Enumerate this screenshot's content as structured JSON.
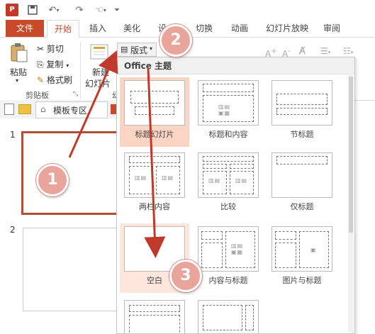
{
  "app_icon": "P",
  "qat": {
    "save_icon": "save-icon",
    "undo_icon": "undo-icon",
    "redo_icon": "redo-icon",
    "touch_icon": "touch-icon"
  },
  "tabs": [
    {
      "label": "文件"
    },
    {
      "label": "开始"
    },
    {
      "label": "插入"
    },
    {
      "label": "美化"
    },
    {
      "label": "设"
    },
    {
      "label": "切换"
    },
    {
      "label": "动画"
    },
    {
      "label": "幻灯片放映"
    },
    {
      "label": "审阅"
    }
  ],
  "ribbon": {
    "paste": "粘贴",
    "cut": "剪切",
    "copy": "复制",
    "format_painter": "格式刷",
    "clipboard_group": "剪贴板",
    "new_slide": "新建",
    "new_slide_2": "幻灯片",
    "layout_button": "版式",
    "slides_group_partial": "幻"
  },
  "slides_pane": {
    "tab_label": "模板专区",
    "thumbs": [
      "1",
      "2"
    ]
  },
  "dropdown": {
    "header": "Office 主题",
    "layouts": [
      {
        "name": "标题幻灯片"
      },
      {
        "name": "标题和内容"
      },
      {
        "name": "节标题"
      },
      {
        "name": "两栏内容"
      },
      {
        "name": "比较"
      },
      {
        "name": "仅标题"
      },
      {
        "name": "空白"
      },
      {
        "name": "内容与标题"
      },
      {
        "name": "图片与标题"
      }
    ]
  },
  "annotations": [
    "1",
    "2",
    "3"
  ],
  "colors": {
    "accent": "#c84a2a",
    "badge": "#e9a49b",
    "arrow": "#c0392b"
  }
}
